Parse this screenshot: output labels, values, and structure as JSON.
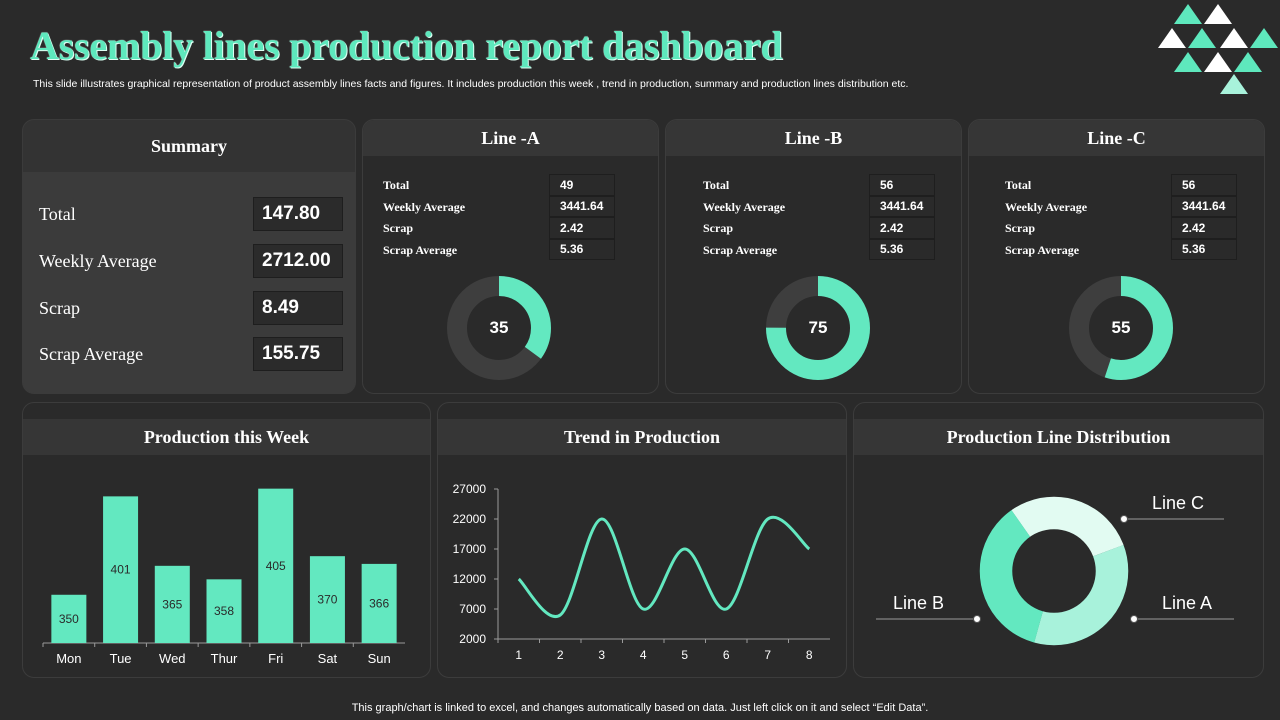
{
  "header": {
    "title": "Assembly lines production report dashboard",
    "subtitle": "This slide illustrates graphical representation of product assembly lines facts and figures. It includes production this week , trend in production, summary and production lines distribution etc."
  },
  "colors": {
    "accent": "#63e8c0",
    "accent_light": "#a8f2db",
    "accent_pale": "#e2fbf2",
    "track": "#3e3e3e",
    "background": "#2a2a2a"
  },
  "summary": {
    "title": "Summary",
    "rows": [
      {
        "label": "Total",
        "value": "147.80"
      },
      {
        "label": "Weekly Average",
        "value": "2712.00"
      },
      {
        "label": "Scrap",
        "value": "8.49"
      },
      {
        "label": "Scrap Average",
        "value": "155.75"
      }
    ]
  },
  "lines": [
    {
      "title": "Line -A",
      "percent": 35,
      "percent_label": "35",
      "rows": [
        {
          "label": "Total",
          "value": "49"
        },
        {
          "label": "Weekly Average",
          "value": "3441.64"
        },
        {
          "label": "Scrap",
          "value": "2.42"
        },
        {
          "label": "Scrap Average",
          "value": "5.36"
        }
      ]
    },
    {
      "title": "Line -B",
      "percent": 75,
      "percent_label": "75",
      "rows": [
        {
          "label": "Total",
          "value": "56"
        },
        {
          "label": "Weekly Average",
          "value": "3441.64"
        },
        {
          "label": "Scrap",
          "value": "2.42"
        },
        {
          "label": "Scrap Average",
          "value": "5.36"
        }
      ]
    },
    {
      "title": "Line -C",
      "percent": 55,
      "percent_label": "55",
      "rows": [
        {
          "label": "Total",
          "value": "56"
        },
        {
          "label": "Weekly Average",
          "value": "3441.64"
        },
        {
          "label": "Scrap",
          "value": "2.42"
        },
        {
          "label": "Scrap Average",
          "value": "5.36"
        }
      ]
    }
  ],
  "panels": {
    "week_title": "Production this Week",
    "trend_title": "Trend in Production",
    "distribution_title": "Production Line Distribution"
  },
  "chart_data": [
    {
      "type": "bar",
      "categories": [
        "Mon",
        "Tue",
        "Wed",
        "Thur",
        "Fri",
        "Sat",
        "Sun"
      ],
      "values": [
        350,
        401,
        365,
        358,
        405,
        370,
        366
      ],
      "data_labels": true,
      "ylim": [
        325,
        410
      ]
    },
    {
      "type": "line",
      "smooth": true,
      "x": [
        1,
        2,
        3,
        4,
        5,
        6,
        7,
        8
      ],
      "values": [
        12000,
        6000,
        22000,
        7000,
        17000,
        7000,
        22000,
        17000
      ],
      "xticks": [
        "1",
        "2",
        "3",
        "4",
        "5",
        "6",
        "7",
        "8"
      ],
      "yticks": [
        "27000",
        "22000",
        "17000",
        "12000",
        "7000",
        "2000"
      ],
      "ylim": [
        2000,
        27000
      ]
    },
    {
      "type": "pie",
      "donut": true,
      "series": [
        {
          "name": "Line A",
          "value": 35
        },
        {
          "name": "Line B",
          "value": 36
        },
        {
          "name": "Line C",
          "value": 29
        }
      ]
    }
  ],
  "footer": "This graph/chart is linked to excel,  and changes automatically based on data. Just left click on it and select “Edit Data”."
}
